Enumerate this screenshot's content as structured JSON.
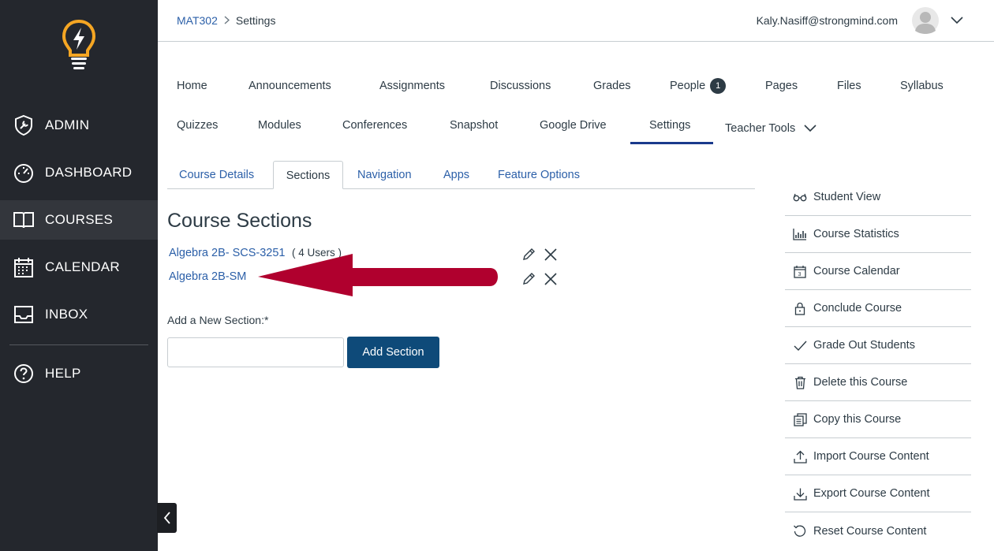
{
  "sidebar": {
    "items": [
      {
        "label": "ADMIN",
        "icon": "shield-wrench-icon"
      },
      {
        "label": "DASHBOARD",
        "icon": "speedometer-icon"
      },
      {
        "label": "COURSES",
        "icon": "book-icon"
      },
      {
        "label": "CALENDAR",
        "icon": "calendar-icon"
      },
      {
        "label": "INBOX",
        "icon": "inbox-icon"
      }
    ],
    "help_label": "HELP"
  },
  "header": {
    "breadcrumb": [
      "MAT302",
      "Settings"
    ],
    "user_email": "Kaly.Nasiff@strongmind.com"
  },
  "course_nav": {
    "items": [
      "Home",
      "Announcements",
      "Assignments",
      "Discussions",
      "Grades",
      "People",
      "Pages",
      "Files",
      "Syllabus",
      "Quizzes",
      "Modules",
      "Conferences",
      "Snapshot",
      "Google Drive",
      "Settings",
      "Teacher Tools"
    ],
    "people_badge": "1",
    "active": "Settings"
  },
  "tabs": {
    "items": [
      "Course Details",
      "Sections",
      "Navigation",
      "Apps",
      "Feature Options"
    ],
    "active": "Sections"
  },
  "sections": {
    "title": "Course Sections",
    "rows": [
      {
        "name": "Algebra 2B- SCS-3251",
        "users": "( 4 Users )"
      },
      {
        "name": "Algebra 2B-SM",
        "users": ""
      }
    ],
    "add_label": "Add a New Section:*",
    "add_value": "",
    "add_button": "Add Section"
  },
  "right_sidebar": {
    "items": [
      {
        "label": "Student View",
        "icon": "glasses-icon"
      },
      {
        "label": "Course Statistics",
        "icon": "bar-chart-icon"
      },
      {
        "label": "Course Calendar",
        "icon": "calendar-icon"
      },
      {
        "label": "Conclude Course",
        "icon": "lock-icon"
      },
      {
        "label": "Grade Out Students",
        "icon": "checkmark-icon"
      },
      {
        "label": "Delete this Course",
        "icon": "trash-icon"
      },
      {
        "label": "Copy this Course",
        "icon": "copy-icon"
      },
      {
        "label": "Import Course Content",
        "icon": "upload-icon"
      },
      {
        "label": "Export Course Content",
        "icon": "download-icon"
      },
      {
        "label": "Reset Course Content",
        "icon": "reset-icon"
      }
    ]
  },
  "colors": {
    "sidebar_bg": "#24272d",
    "link": "#2b5fa8",
    "button": "#0e4a79",
    "arrow": "#b0002e",
    "logo_orange": "#f5a623"
  }
}
